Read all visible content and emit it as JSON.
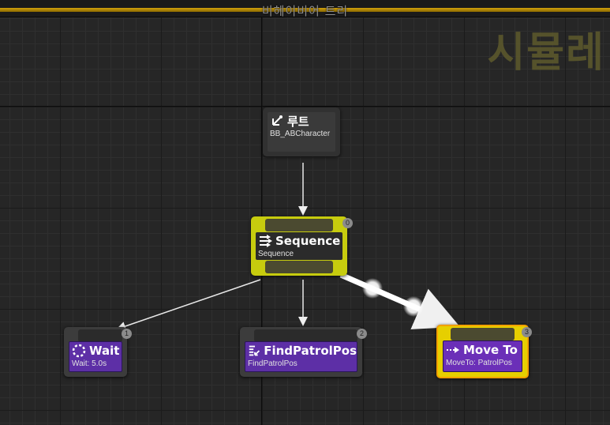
{
  "window": {
    "title": "비헤이비어 트리",
    "watermark": "시뮬레"
  },
  "nodes": {
    "root": {
      "title": "루트",
      "subtitle": "BB_ABCharacter"
    },
    "sequence": {
      "title": "Sequence",
      "subtitle": "Sequence",
      "index": "0"
    },
    "wait": {
      "title": "Wait",
      "subtitle": "Wait: 5.0s",
      "index": "1"
    },
    "find": {
      "title": "FindPatrolPos",
      "subtitle": "FindPatrolPos",
      "index": "2"
    },
    "move": {
      "title": "Move To",
      "subtitle": "MoveTo: PatrolPos",
      "index": "3"
    }
  },
  "colors": {
    "background": "#262626",
    "title_accent": "#d1a10b",
    "composite_active": "#c7cc0e",
    "task": "#5d2fa6",
    "active_border": "#f2a000",
    "link": "#e8e8e8"
  },
  "icons": {
    "root": "root-branch-icon",
    "sequence": "sequence-arrows-icon",
    "wait": "wait-spinner-icon",
    "find": "task-list-icon",
    "move": "move-arrow-icon"
  },
  "active_node": "move"
}
